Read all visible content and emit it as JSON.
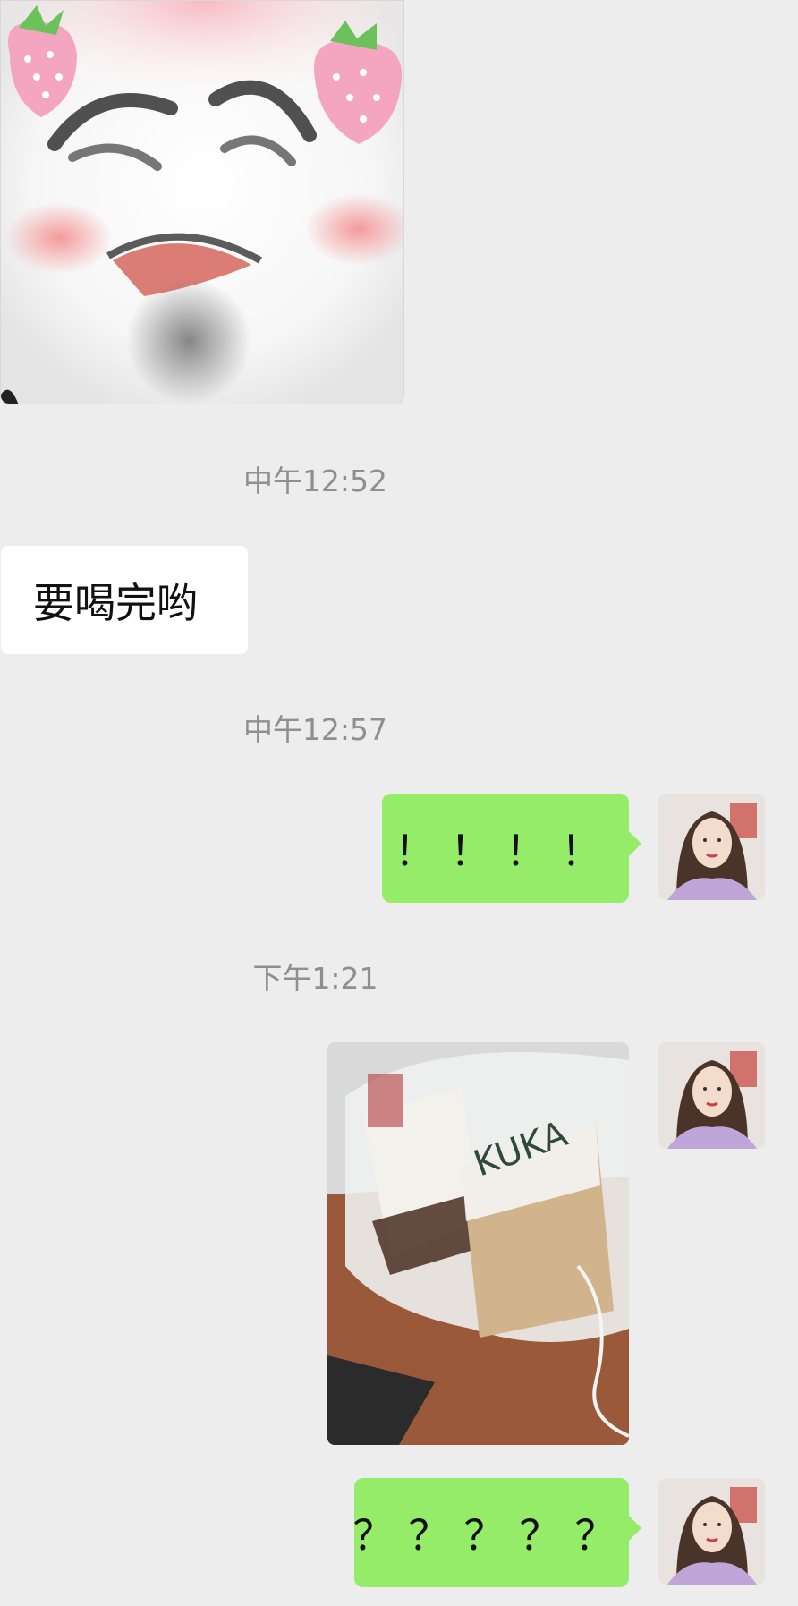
{
  "chat": {
    "messages": [
      {
        "type": "sticker",
        "sender": "other",
        "sticker_name": "crying-face-sticker"
      },
      {
        "type": "timestamp",
        "text": "中午12:52"
      },
      {
        "type": "text",
        "sender": "other",
        "text": "要喝完哟"
      },
      {
        "type": "timestamp",
        "text": "中午12:57"
      },
      {
        "type": "text",
        "sender": "self",
        "text": "！！！！"
      },
      {
        "type": "timestamp",
        "text": "下午1:21"
      },
      {
        "type": "image",
        "sender": "self",
        "image_name": "milk-tea-photo"
      },
      {
        "type": "text",
        "sender": "self",
        "text": "？？？？？"
      }
    ]
  },
  "colors": {
    "background": "#ededed",
    "bubble_out": "#95ec69",
    "bubble_in": "#ffffff",
    "timestamp_text": "#8f8f8f"
  }
}
